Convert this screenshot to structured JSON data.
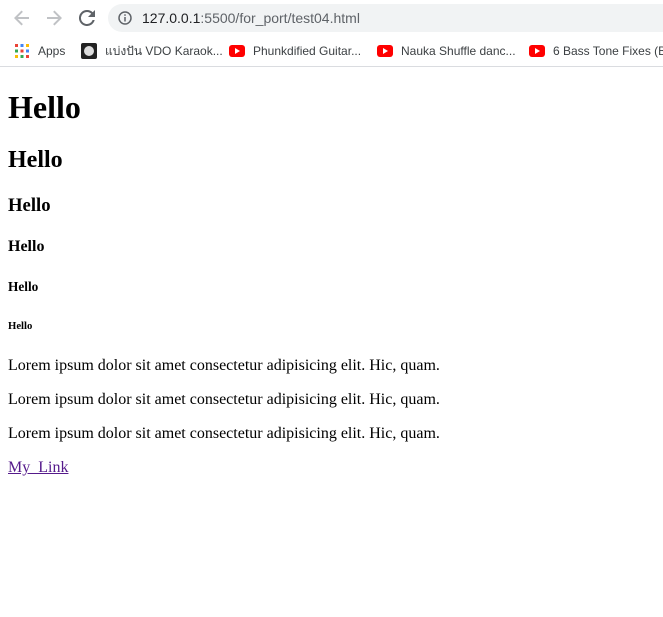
{
  "browser": {
    "address_host": "127.0.0.1",
    "address_rest": ":5500/for_port/test04.html",
    "bookmarks": [
      {
        "label": "Apps",
        "icon": "apps-grid-icon"
      },
      {
        "label": "แบ่งปัน VDO Karaok...",
        "icon": "karaoke-favicon"
      },
      {
        "label": "Phunkdified Guitar...",
        "icon": "youtube-icon"
      },
      {
        "label": "Nauka Shuffle danc...",
        "icon": "youtube-icon"
      },
      {
        "label": "6 Bass Tone Fixes (B...",
        "icon": "youtube-icon"
      }
    ]
  },
  "page": {
    "h1": "Hello",
    "h2": "Hello",
    "h3": "Hello",
    "h4": "Hello",
    "h5": "Hello",
    "h6": "Hello",
    "paragraphs": [
      "Lorem ipsum dolor sit amet consectetur adipisicing elit. Hic, quam.",
      "Lorem ipsum dolor sit amet consectetur adipisicing elit. Hic, quam.",
      "Lorem ipsum dolor sit amet consectetur adipisicing elit. Hic, quam."
    ],
    "link": "My_Link"
  },
  "colors": {
    "link_visited": "#551a8b",
    "omnibox_bg": "#f1f3f4",
    "youtube_red": "#ff0000"
  }
}
